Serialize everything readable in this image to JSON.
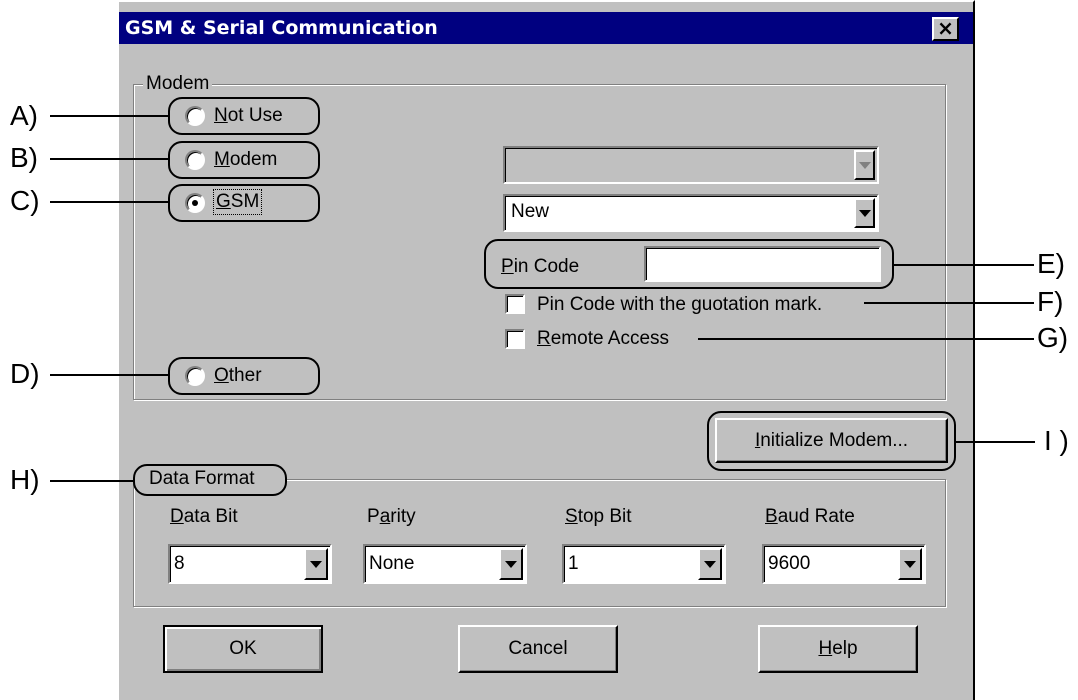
{
  "dialog": {
    "title": "GSM & Serial Communication",
    "close_label": "×"
  },
  "modem_group": {
    "legend": "Modem",
    "options": [
      {
        "key": "not_use",
        "pre": "",
        "u": "N",
        "post": "ot Use",
        "selected": false
      },
      {
        "key": "modem",
        "pre": "",
        "u": "M",
        "post": "odem",
        "selected": false
      },
      {
        "key": "gsm",
        "pre": "",
        "u": "G",
        "post": "SM",
        "selected": true
      },
      {
        "key": "other",
        "pre": "",
        "u": "O",
        "post": "ther",
        "selected": false
      }
    ],
    "modem_combo_value": "",
    "gsm_combo_value": "New",
    "pin_code": {
      "label_u": "P",
      "label_rest": "in Code",
      "value": ""
    },
    "pin_quote_checkbox": {
      "label": "Pin Code with the guotation mark.",
      "checked": false
    },
    "remote_access_checkbox": {
      "label_u": "R",
      "label_rest": "emote Access",
      "checked": false
    }
  },
  "initialize_button": {
    "u": "I",
    "rest": "nitialize Modem..."
  },
  "data_format": {
    "legend": "Data Format",
    "fields": [
      {
        "pre": "",
        "u": "D",
        "post": "ata Bit",
        "value": "8"
      },
      {
        "pre": "P",
        "u": "a",
        "post": "rity",
        "value": "None"
      },
      {
        "pre": "",
        "u": "S",
        "post": "top Bit",
        "value": "1"
      },
      {
        "pre": "",
        "u": "B",
        "post": "aud Rate",
        "value": "9600"
      }
    ]
  },
  "buttons": {
    "ok": "OK",
    "cancel": "Cancel",
    "help_u": "H",
    "help_rest": "elp"
  },
  "callouts": {
    "a": "A)",
    "b": "B)",
    "c": "C)",
    "d": "D)",
    "e": "E)",
    "f": "F)",
    "g": "G)",
    "h": "H)",
    "i": "I )"
  }
}
